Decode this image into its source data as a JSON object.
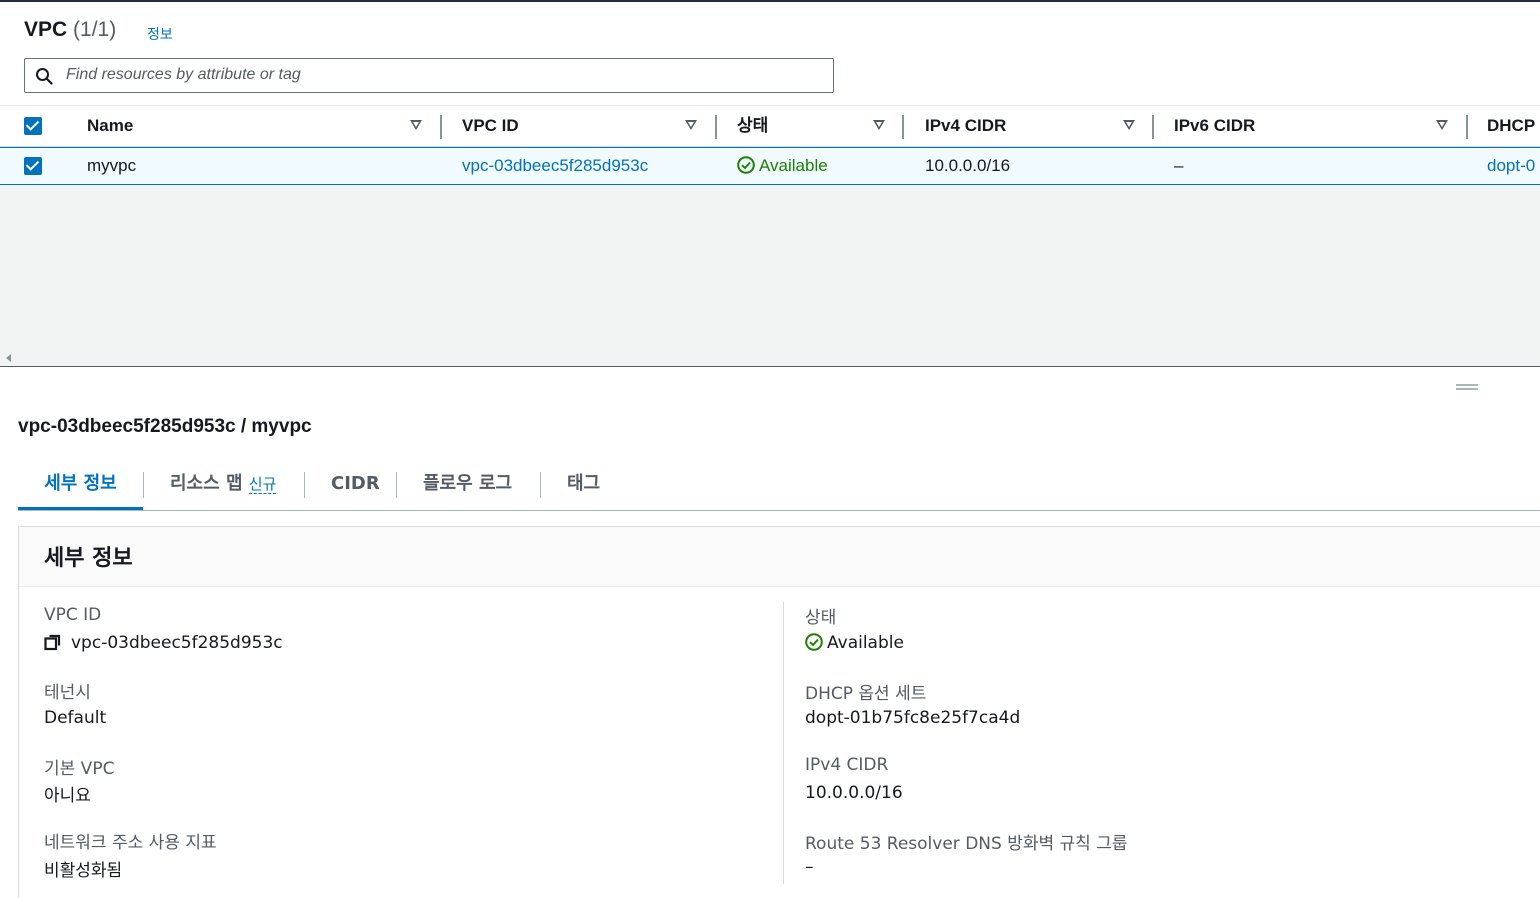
{
  "header": {
    "title": "VPC",
    "count": "(1/1)",
    "info_link": "정보"
  },
  "search": {
    "placeholder": "Find resources by attribute or tag"
  },
  "table": {
    "columns": [
      "Name",
      "VPC ID",
      "상태",
      "IPv4 CIDR",
      "IPv6 CIDR",
      "DHCP"
    ],
    "rows": [
      {
        "name": "myvpc",
        "vpc_id": "vpc-03dbeec5f285d953c",
        "state": "Available",
        "ipv4_cidr": "10.0.0.0/16",
        "ipv6_cidr": "–",
        "dhcp": "dopt-0"
      }
    ]
  },
  "detail": {
    "title": "vpc-03dbeec5f285d953c / myvpc",
    "tabs": [
      {
        "label": "세부 정보"
      },
      {
        "label": "리소스 맵",
        "badge": "신규"
      },
      {
        "label": "CIDR"
      },
      {
        "label": "플로우 로그"
      },
      {
        "label": "태그"
      }
    ],
    "card_title": "세부 정보",
    "left": [
      {
        "label": "VPC ID",
        "value": "vpc-03dbeec5f285d953c"
      },
      {
        "label": "테넌시",
        "value": "Default"
      },
      {
        "label": "기본 VPC",
        "value": "아니요"
      },
      {
        "label": "네트워크 주소 사용 지표",
        "value": "비활성화됨"
      }
    ],
    "right": [
      {
        "label": "상태",
        "value": "Available"
      },
      {
        "label": "DHCP 옵션 세트",
        "value": "dopt-01b75fc8e25f7ca4d"
      },
      {
        "label": "IPv4 CIDR",
        "value": "10.0.0.0/16"
      },
      {
        "label": "Route 53 Resolver DNS 방화벽 규칙 그룹",
        "value": "–"
      }
    ]
  },
  "colors": {
    "link": "#0073bb",
    "success": "#1d8102",
    "selected_row_bg": "#f1faff"
  }
}
